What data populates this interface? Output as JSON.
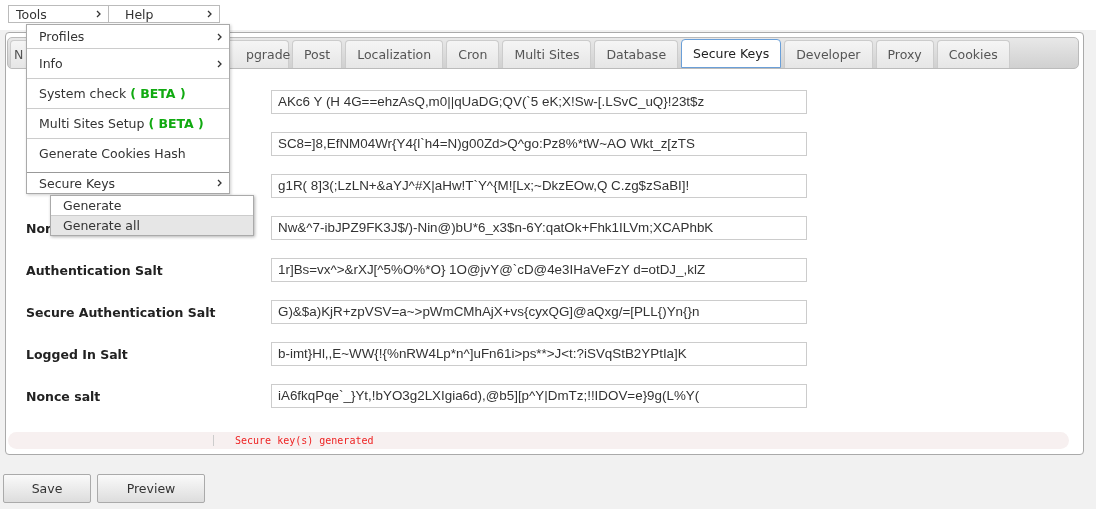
{
  "menubar": [
    {
      "label": "Tools"
    },
    {
      "label": "Help"
    }
  ],
  "tools_menu": {
    "items": [
      {
        "label": "Profiles",
        "has_submenu": true
      },
      {
        "label": "Info",
        "has_submenu": true
      },
      {
        "label": "System check",
        "badge": "( BETA )",
        "has_submenu": false
      },
      {
        "label": "Multi Sites Setup",
        "badge": "( BETA )",
        "has_submenu": false
      },
      {
        "label": "Generate Cookies Hash",
        "has_submenu": false
      },
      {
        "label": "Secure Keys",
        "has_submenu": true
      }
    ]
  },
  "secure_keys_submenu": {
    "items": [
      {
        "label": "Generate",
        "selected": false
      },
      {
        "label": "Generate all",
        "selected": true
      }
    ]
  },
  "tabs": [
    {
      "label": "N",
      "selected": false
    },
    {
      "label": "pgrade",
      "selected": false
    },
    {
      "label": "Post",
      "selected": false
    },
    {
      "label": "Localization",
      "selected": false
    },
    {
      "label": "Cron",
      "selected": false
    },
    {
      "label": "Multi Sites",
      "selected": false
    },
    {
      "label": "Database",
      "selected": false
    },
    {
      "label": "Secure Keys",
      "selected": true
    },
    {
      "label": "Developer",
      "selected": false
    },
    {
      "label": "Proxy",
      "selected": false
    },
    {
      "label": "Cookies",
      "selected": false
    }
  ],
  "fields": [
    {
      "value": "AKc6 Y (H 4G==ehzAsQ,m0||qUaDG;QV(`5 eK;X!Sw-[.LSvC_uQ}!23t$z"
    },
    {
      "value": "SC8=]8,EfNM04Wr{Y4{l`h4=N)g00Zd>Q^go:Pz8%*tW~AO Wkt_z[zTS"
    },
    {
      "value": "g1R( 8]3(;LzLN+&aYJ^#X|aHw!T`Y^{M![Lx;~DkzEOw,Q C.zg$zSaBI]!"
    },
    {
      "label": "Nor",
      "value": "Nw&^7-ibJPZ9FK3J$/)-Nin@)bU*6_x3$n-6Y:qatOk+Fhk1ILVm;XCAPhbK"
    },
    {
      "label": "Authentication Salt",
      "value": "1r]Bs=vx^>&rXJ[^5%O%*O} 1O@jvY@`cD@4e3IHaVeFzY d=otDJ_,klZ"
    },
    {
      "label": "Secure Authentication Salt",
      "value": "G)&$a)KjR+zpVSV=a~>pWmCMhAjX+vs{cyxQG]@aQxg/=[PLL{)Yn{}n"
    },
    {
      "label": "Logged In Salt",
      "value": "b-imt}Hl,,E~WW{!{%nRW4Lp*n^]uFn61i>ps**>J<t:?iSVqStB2YPtIa]K"
    },
    {
      "label": "Nonce salt",
      "value": "iA6fkqPqe`_}Yt,!bYO3g2LXIgia6d),@b5][p^Y|DmTz;!!IDOV=e}9g(L%Y("
    }
  ],
  "status_message": "Secure key(s) generated",
  "buttons": [
    "Save",
    "Preview"
  ]
}
